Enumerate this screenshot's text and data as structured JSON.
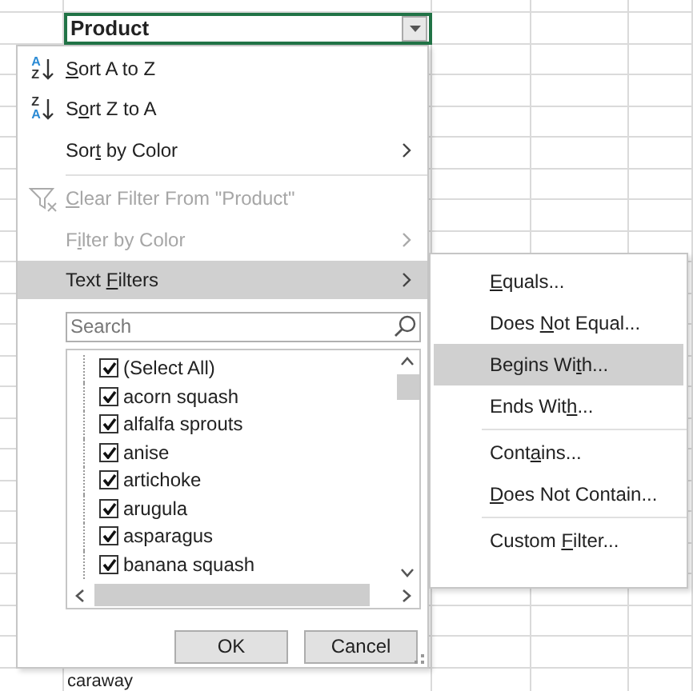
{
  "sheet": {
    "header_cell": "Product",
    "bottom_cell": "caraway"
  },
  "menu": {
    "items": [
      {
        "kind": "item",
        "label": "Sort A to Z",
        "icon_letters": [
          "A",
          "Z"
        ],
        "disabled": false,
        "submenu": false,
        "selected": false
      },
      {
        "kind": "item",
        "label": "Sort Z to A",
        "icon_letters": [
          "Z",
          "A"
        ],
        "disabled": false,
        "submenu": false,
        "selected": false
      },
      {
        "kind": "item",
        "label": "Sort by Color",
        "disabled": false,
        "submenu": true,
        "selected": false
      },
      {
        "kind": "separator"
      },
      {
        "kind": "item",
        "label": "Clear Filter From \"Product\"",
        "disabled": true,
        "submenu": false,
        "selected": false
      },
      {
        "kind": "item",
        "label": "Filter by Color",
        "disabled": true,
        "submenu": true,
        "selected": false
      },
      {
        "kind": "item",
        "label": "Text Filters",
        "disabled": false,
        "submenu": true,
        "selected": true
      }
    ],
    "search": {
      "placeholder": "Search"
    },
    "values": [
      {
        "label": "(Select All)",
        "checked": true
      },
      {
        "label": "acorn squash",
        "checked": true
      },
      {
        "label": "alfalfa sprouts",
        "checked": true
      },
      {
        "label": "anise",
        "checked": true
      },
      {
        "label": "artichoke",
        "checked": true
      },
      {
        "label": "arugula",
        "checked": true
      },
      {
        "label": "asparagus",
        "checked": true
      },
      {
        "label": "banana squash",
        "checked": true
      }
    ],
    "buttons": [
      "OK",
      "Cancel"
    ]
  },
  "submenu": {
    "items": [
      {
        "kind": "item",
        "label": "Equals...",
        "selected": false
      },
      {
        "kind": "item",
        "label": "Does Not Equal...",
        "selected": false
      },
      {
        "kind": "item",
        "label": "Begins With...",
        "selected": true
      },
      {
        "kind": "item",
        "label": "Ends With...",
        "selected": false
      },
      {
        "kind": "separator"
      },
      {
        "kind": "item",
        "label": "Contains...",
        "selected": false
      },
      {
        "kind": "item",
        "label": "Does Not Contain...",
        "selected": false
      },
      {
        "kind": "separator"
      },
      {
        "kind": "item",
        "label": "Custom Filter...",
        "selected": false
      }
    ]
  }
}
